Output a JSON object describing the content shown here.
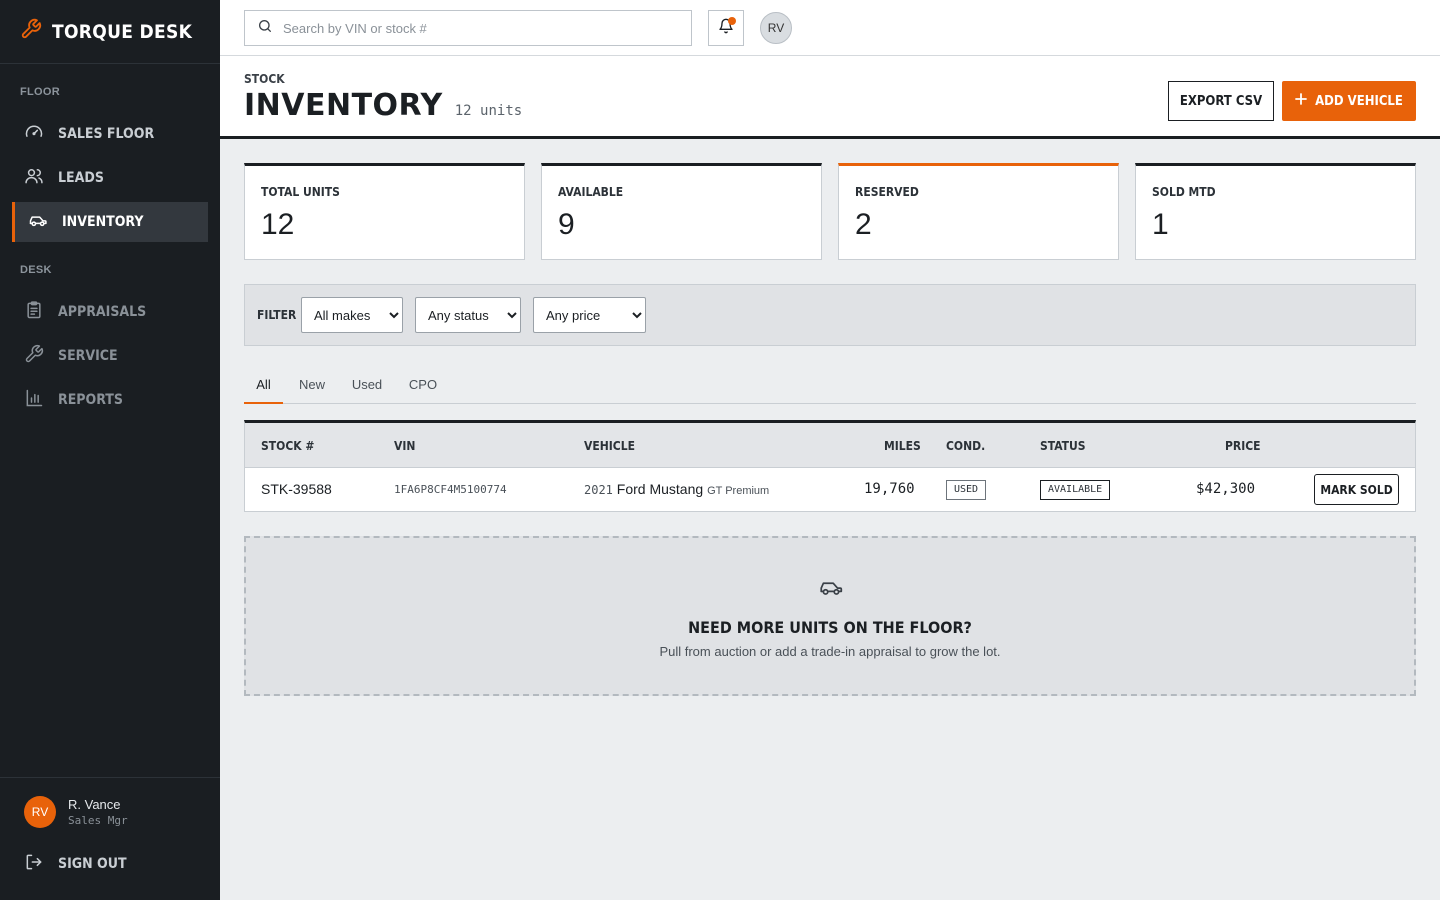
{
  "brand": {
    "name": "TORQUE DESK"
  },
  "sidebar": {
    "sections": [
      {
        "label": "FLOOR"
      },
      {
        "label": "DESK"
      }
    ],
    "items": [
      {
        "label": "SALES FLOOR",
        "icon": "gauge-icon"
      },
      {
        "label": "LEADS",
        "icon": "users-icon"
      },
      {
        "label": "INVENTORY",
        "icon": "car-icon",
        "active": true
      },
      {
        "label": "APPRAISALS",
        "icon": "clipboard-icon"
      },
      {
        "label": "SERVICE",
        "icon": "wrench-icon"
      },
      {
        "label": "REPORTS",
        "icon": "bar-chart-icon"
      }
    ],
    "user": {
      "initials": "RV",
      "name": "R. Vance",
      "role": "Sales Mgr"
    },
    "signout_label": "SIGN OUT"
  },
  "topbar": {
    "search_placeholder": "Search by VIN or stock #",
    "avatar_initials": "RV"
  },
  "header": {
    "eyebrow": "STOCK",
    "title": "INVENTORY",
    "count": "12 units",
    "export_label": "EXPORT CSV",
    "add_label": "ADD VEHICLE"
  },
  "stats": [
    {
      "label": "TOTAL UNITS",
      "value": "12"
    },
    {
      "label": "AVAILABLE",
      "value": "9"
    },
    {
      "label": "RESERVED",
      "value": "2"
    },
    {
      "label": "SOLD MTD",
      "value": "1"
    }
  ],
  "filter": {
    "label": "FILTER",
    "makes": "All makes",
    "status": "Any status",
    "price": "Any price"
  },
  "tabs": [
    "All",
    "New",
    "Used",
    "CPO"
  ],
  "table": {
    "columns": [
      "STOCK #",
      "VIN",
      "VEHICLE",
      "MILES",
      "COND.",
      "STATUS",
      "PRICE"
    ],
    "rows": [
      {
        "stock": "STK-39588",
        "vin": "1FA6P8CF4M5100774",
        "year": "2021",
        "model": "Ford Mustang",
        "trim": "GT Premium",
        "miles": "19,760",
        "cond": "USED",
        "status": "AVAILABLE",
        "price": "$42,300",
        "action": "MARK SOLD"
      }
    ]
  },
  "empty_state": {
    "title": "NEED MORE UNITS ON THE FLOOR?",
    "subtitle": "Pull from auction or add a trade-in appraisal to grow the lot."
  },
  "colors": {
    "accent": "#e8620a",
    "sidebar": "#1a1e22",
    "background": "#eceef0"
  }
}
